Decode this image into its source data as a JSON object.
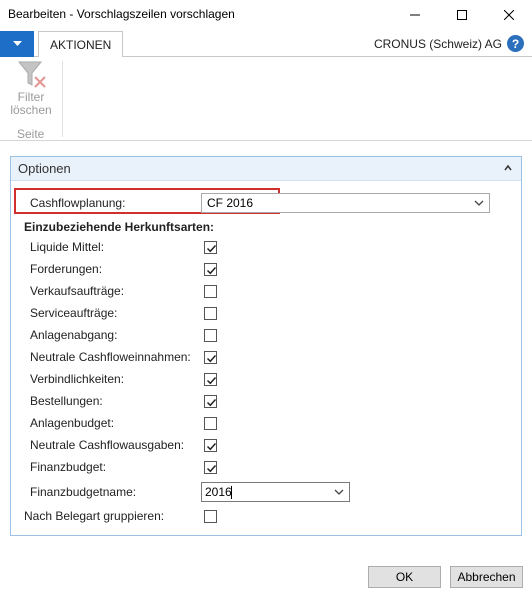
{
  "window": {
    "title": "Bearbeiten - Vorschlagszeilen vorschlagen"
  },
  "ribbon": {
    "tab": "AKTIONEN",
    "company": "CRONUS (Schweiz) AG",
    "help_glyph": "?",
    "filter_button_line1": "Filter",
    "filter_button_line2": "löschen",
    "group_label": "Seite"
  },
  "panel": {
    "title": "Optionen",
    "cashflow_label": "Cashflowplanung:",
    "cashflow_value": "CF 2016",
    "section_heading": "Einzubeziehende Herkunftsarten:",
    "options": [
      {
        "label": "Liquide Mittel:",
        "checked": true
      },
      {
        "label": "Forderungen:",
        "checked": true
      },
      {
        "label": "Verkaufsaufträge:",
        "checked": false
      },
      {
        "label": "Serviceaufträge:",
        "checked": false
      },
      {
        "label": "Anlagenabgang:",
        "checked": false
      },
      {
        "label": "Neutrale Cashfloweinnahmen:",
        "checked": true
      },
      {
        "label": "Verbindlichkeiten:",
        "checked": true
      },
      {
        "label": "Bestellungen:",
        "checked": true
      },
      {
        "label": "Anlagenbudget:",
        "checked": false
      },
      {
        "label": "Neutrale Cashflowausgaben:",
        "checked": true
      },
      {
        "label": "Finanzbudget:",
        "checked": true
      }
    ],
    "finanzbudgetname_label": "Finanzbudgetname:",
    "finanzbudgetname_value": "2016",
    "group_label": "Nach Belegart gruppieren:",
    "group_checked": false
  },
  "buttons": {
    "ok": "OK",
    "cancel": "Abbrechen"
  },
  "colors": {
    "accent": "#1e6ec8",
    "panel_border": "#9dc2e6",
    "highlight": "#d32f2f"
  }
}
